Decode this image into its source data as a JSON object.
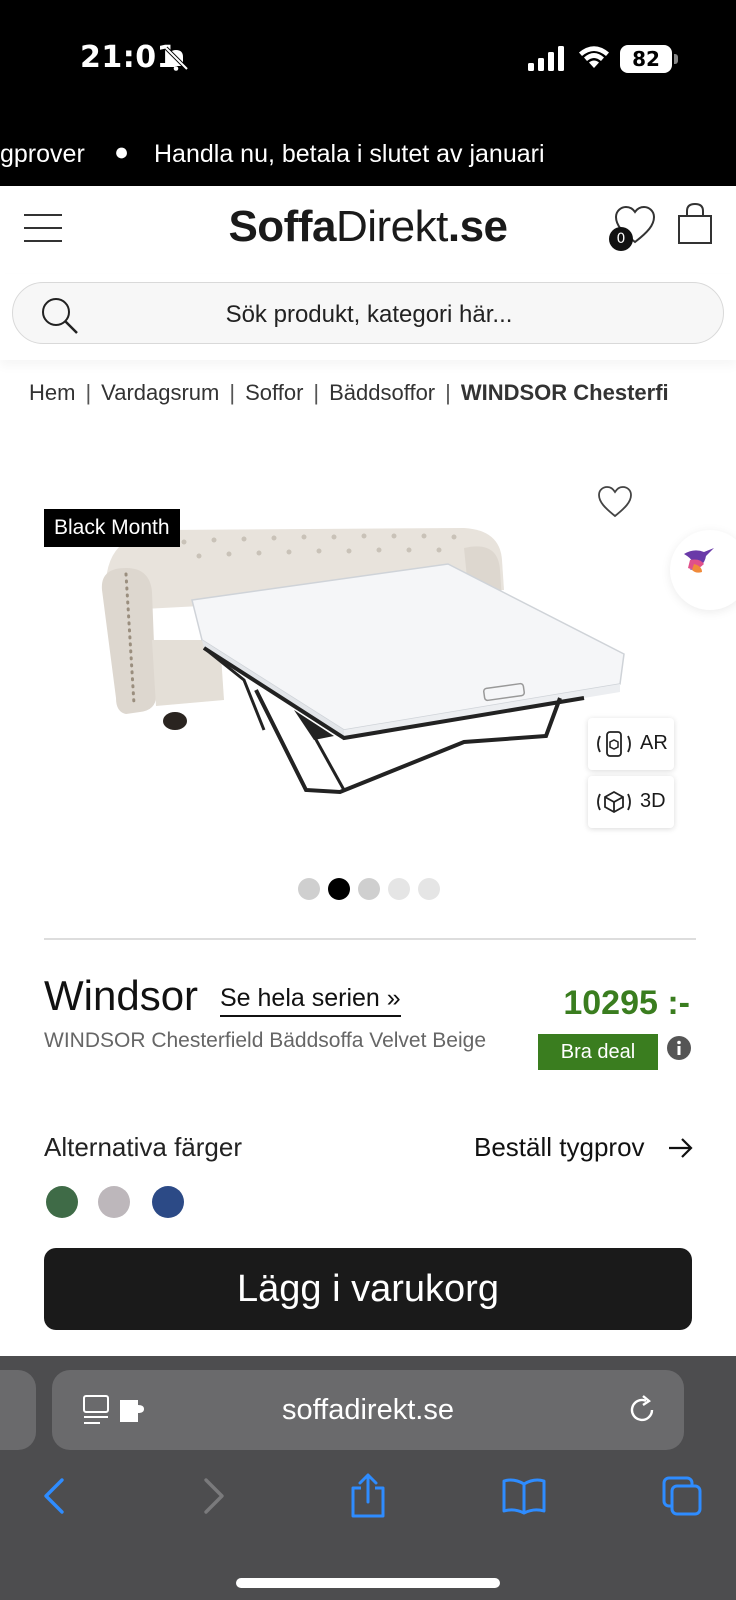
{
  "status": {
    "time": "21:01",
    "battery": "82"
  },
  "marquee": {
    "text_left": "gprover",
    "separator": "●",
    "text_right": "Handla nu, betala i slutet av januari"
  },
  "header": {
    "logo_part1": "Soffa",
    "logo_part2": "Direkt",
    "logo_part3": ".se",
    "wishlist_count": "0"
  },
  "search": {
    "placeholder": "Sök produkt, kategori här..."
  },
  "breadcrumb": {
    "items": [
      "Hem",
      "Vardagsrum",
      "Soffor",
      "Bäddsoffor",
      "WINDSOR Chesterfi"
    ],
    "separator": "|"
  },
  "product": {
    "badge": "Black Month",
    "ar_label": "AR",
    "three_d_label": "3D",
    "image_dots": 5,
    "active_dot": 1,
    "title": "Windsor",
    "series_link": "Se hela serien »",
    "subtitle": "WINDSOR Chesterfield Bäddsoffa Velvet Beige",
    "price": "10295 :-",
    "deal_label": "Bra deal",
    "alt_colors_label": "Alternativa färger",
    "fabric_sample_link": "Beställ tygprov",
    "colors": [
      "#3f6b47",
      "#bdb7bb",
      "#2c4a86"
    ],
    "add_to_cart": "Lägg i varukorg"
  },
  "theme": {
    "price_green": "#3a7d1f",
    "dark": "#1a1a1a"
  },
  "browser": {
    "url": "soffadirekt.se"
  }
}
